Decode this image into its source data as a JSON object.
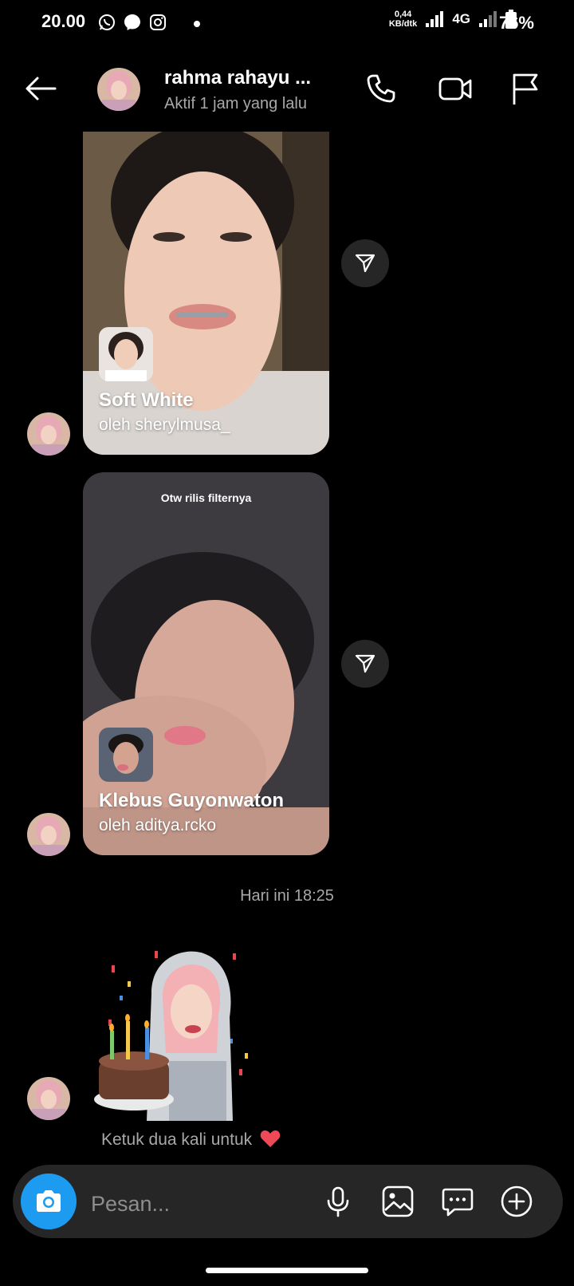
{
  "status_bar": {
    "time": "20.00",
    "net_speed_value": "0,44",
    "net_speed_unit": "KB/dtk",
    "network": "4G",
    "battery": "76%"
  },
  "header": {
    "name": "rahma rahayu ...",
    "status": "Aktif 1 jam yang lalu"
  },
  "messages": {
    "card1": {
      "title": "Soft White",
      "author": "oleh sherylmusa_"
    },
    "card2": {
      "caption": "Otw rilis filternya",
      "title": "Klebus Guyonwaton",
      "author": "oleh aditya.rcko"
    },
    "timestamp": "Hari ini 18:25",
    "tap_hint": "Ketuk dua kali untuk"
  },
  "composer": {
    "placeholder": "Pesan..."
  },
  "colors": {
    "background": "#000000",
    "accent": "#1d9bf0",
    "composer_bg": "#262626",
    "muted_text": "#a8a8a8",
    "heart": "#ed4956"
  }
}
